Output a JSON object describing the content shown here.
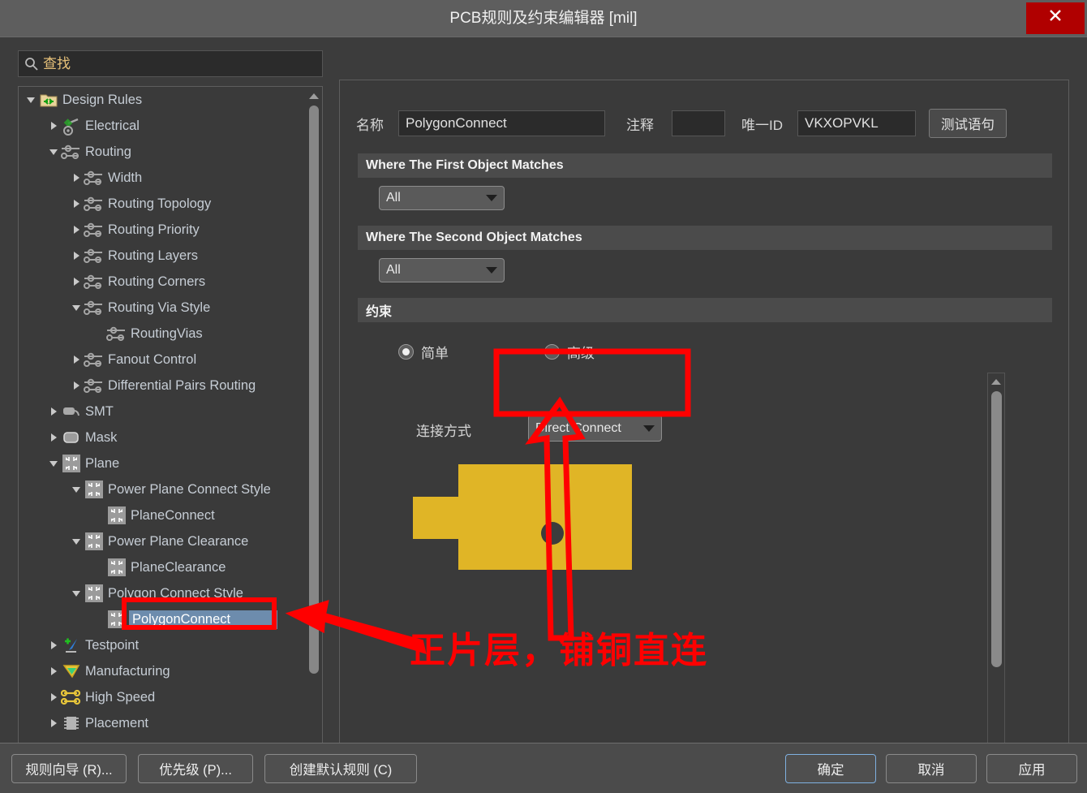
{
  "window": {
    "title": "PCB规则及约束编辑器 [mil]",
    "close_label": "✕"
  },
  "sidebar": {
    "search": {
      "placeholder": "查找",
      "value": "",
      "icon": "search-icon"
    },
    "tree": [
      {
        "label": "Design Rules",
        "depth": 0,
        "state": "open",
        "icon": "folder-rules-icon"
      },
      {
        "label": "Electrical",
        "depth": 1,
        "state": "closed",
        "icon": "electrical-icon"
      },
      {
        "label": "Routing",
        "depth": 1,
        "state": "open",
        "icon": "routing-icon"
      },
      {
        "label": "Width",
        "depth": 2,
        "state": "closed",
        "icon": "routing-icon"
      },
      {
        "label": "Routing Topology",
        "depth": 2,
        "state": "closed",
        "icon": "routing-icon"
      },
      {
        "label": "Routing Priority",
        "depth": 2,
        "state": "closed",
        "icon": "routing-icon"
      },
      {
        "label": "Routing Layers",
        "depth": 2,
        "state": "closed",
        "icon": "routing-icon"
      },
      {
        "label": "Routing Corners",
        "depth": 2,
        "state": "closed",
        "icon": "routing-icon"
      },
      {
        "label": "Routing Via Style",
        "depth": 2,
        "state": "open",
        "icon": "routing-icon"
      },
      {
        "label": "RoutingVias",
        "depth": 3,
        "state": "leaf",
        "icon": "routing-icon"
      },
      {
        "label": "Fanout Control",
        "depth": 2,
        "state": "closed",
        "icon": "routing-icon"
      },
      {
        "label": "Differential Pairs Routing",
        "depth": 2,
        "state": "closed",
        "icon": "routing-icon"
      },
      {
        "label": "SMT",
        "depth": 1,
        "state": "closed",
        "icon": "smt-icon"
      },
      {
        "label": "Mask",
        "depth": 1,
        "state": "closed",
        "icon": "mask-icon"
      },
      {
        "label": "Plane",
        "depth": 1,
        "state": "open",
        "icon": "plane-icon"
      },
      {
        "label": "Power Plane Connect Style",
        "depth": 2,
        "state": "open",
        "icon": "plane-icon"
      },
      {
        "label": "PlaneConnect",
        "depth": 3,
        "state": "leaf",
        "icon": "plane-icon"
      },
      {
        "label": "Power Plane Clearance",
        "depth": 2,
        "state": "open",
        "icon": "plane-icon"
      },
      {
        "label": "PlaneClearance",
        "depth": 3,
        "state": "leaf",
        "icon": "plane-icon"
      },
      {
        "label": "Polygon Connect Style",
        "depth": 2,
        "state": "open",
        "icon": "plane-icon"
      },
      {
        "label": "PolygonConnect",
        "depth": 3,
        "state": "leaf",
        "icon": "plane-icon",
        "selected": true
      },
      {
        "label": "Testpoint",
        "depth": 1,
        "state": "closed",
        "icon": "testpoint-icon"
      },
      {
        "label": "Manufacturing",
        "depth": 1,
        "state": "closed",
        "icon": "manufacturing-icon"
      },
      {
        "label": "High Speed",
        "depth": 1,
        "state": "closed",
        "icon": "highspeed-icon"
      },
      {
        "label": "Placement",
        "depth": 1,
        "state": "closed",
        "icon": "placement-icon"
      }
    ]
  },
  "main": {
    "name_label": "名称",
    "name_value": "PolygonConnect",
    "comment_label": "注释",
    "comment_value": "",
    "uid_label": "唯一ID",
    "uid_value": "VKXOPVKL",
    "test_query_button": "测试语句",
    "first_object_header": "Where The First Object Matches",
    "first_object_value": "All",
    "second_object_header": "Where The Second Object Matches",
    "second_object_value": "All",
    "constraints_header": "约束",
    "radio_simple": "简单",
    "radio_advanced": "高级",
    "selected_mode": "简单",
    "connect_style_label": "连接方式",
    "connect_style_value": "Direct Connect"
  },
  "annotation": {
    "text": "正片层，铺铜直连",
    "color": "#ff0000"
  },
  "footer": {
    "left_buttons": [
      {
        "label": "规则向导 (R)...",
        "name": "rule-wizard-button"
      },
      {
        "label": "优先级 (P)...",
        "name": "priorities-button"
      },
      {
        "label": "创建默认规则 (C)",
        "name": "create-default-rules-button"
      }
    ],
    "right_buttons": [
      {
        "label": "确定",
        "name": "ok-button",
        "primary": true
      },
      {
        "label": "取消",
        "name": "cancel-button",
        "primary": false
      },
      {
        "label": "应用",
        "name": "apply-button",
        "primary": false
      }
    ]
  },
  "colors": {
    "accent_red": "#ff0000",
    "copper": "#e0b526",
    "selection_blue": "#6d8cad",
    "close_red": "#b00000"
  }
}
